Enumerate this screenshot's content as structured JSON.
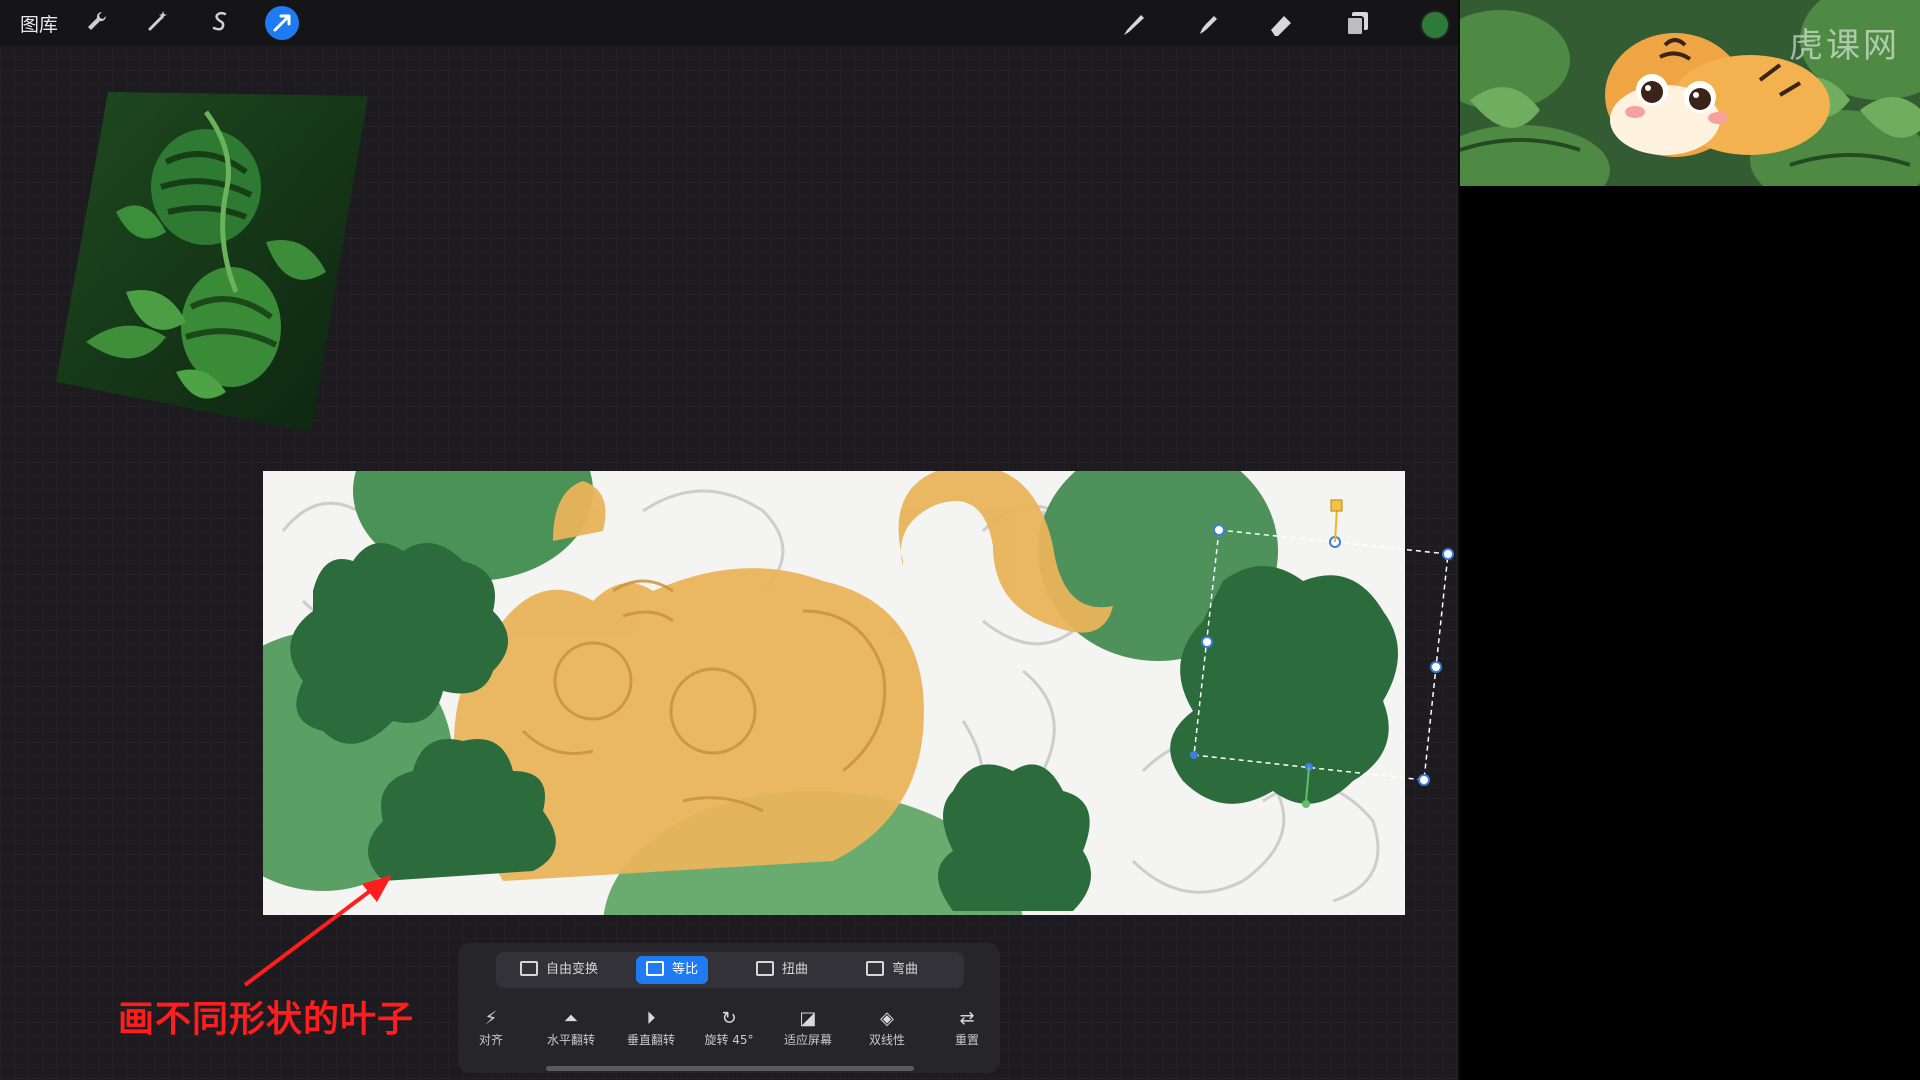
{
  "topbar": {
    "gallery_label": "图库",
    "icons": [
      "wrench-icon",
      "magic-wand-icon",
      "selection-s-icon",
      "transform-arrow-icon"
    ],
    "tools": [
      "brush-icon",
      "smudge-icon",
      "eraser-icon",
      "layers-icon"
    ],
    "current_color": "#2e7a3b"
  },
  "transform_toolbar": {
    "modes": [
      {
        "label": "自由变换",
        "active": false
      },
      {
        "label": "等比",
        "active": true
      },
      {
        "label": "扭曲",
        "active": false
      },
      {
        "label": "弯曲",
        "active": false
      }
    ],
    "actions": [
      {
        "label": "对齐",
        "icon": "snap-icon"
      },
      {
        "label": "水平翻转",
        "icon": "flip-horizontal-icon"
      },
      {
        "label": "垂直翻转",
        "icon": "flip-vertical-icon"
      },
      {
        "label": "旋转 45°",
        "icon": "rotate-icon"
      },
      {
        "label": "适应屏幕",
        "icon": "fit-screen-icon"
      },
      {
        "label": "双线性",
        "icon": "bilinear-icon"
      },
      {
        "label": "重置",
        "icon": "reset-icon"
      }
    ]
  },
  "annotation": {
    "text": "画不同形状的叶子",
    "color": "#ff1d1d"
  },
  "preview": {
    "watermark": "虎课网"
  }
}
